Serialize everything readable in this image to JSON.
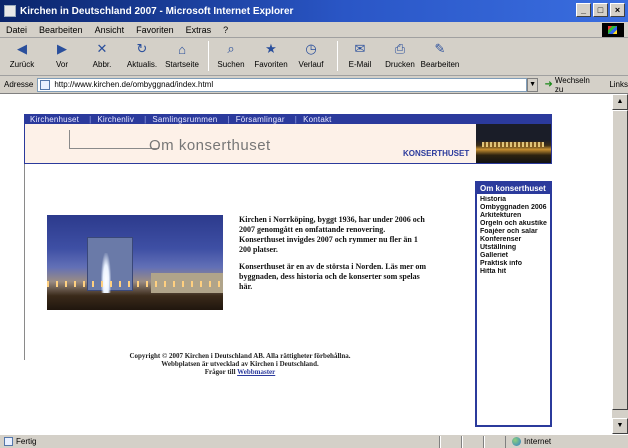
{
  "window": {
    "title": "Kirchen in Deutschland 2007 - Microsoft Internet Explorer"
  },
  "menu": {
    "items": [
      "Datei",
      "Bearbeiten",
      "Ansicht",
      "Favoriten",
      "Extras",
      "?"
    ]
  },
  "toolbar": {
    "buttons": [
      {
        "label": "Zurück",
        "icon": "back-icon"
      },
      {
        "label": "Vor",
        "icon": "forward-icon"
      },
      {
        "label": "Abbr.",
        "icon": "stop-icon"
      },
      {
        "label": "Aktualis.",
        "icon": "refresh-icon"
      },
      {
        "label": "Startseite",
        "icon": "home-icon"
      },
      {
        "label": "Suchen",
        "icon": "search-icon"
      },
      {
        "label": "Favoriten",
        "icon": "favorites-icon"
      },
      {
        "label": "Verlauf",
        "icon": "history-icon"
      },
      {
        "label": "E-Mail",
        "icon": "mail-icon"
      },
      {
        "label": "Drucken",
        "icon": "print-icon"
      },
      {
        "label": "Bearbeiten",
        "icon": "edit-icon"
      }
    ]
  },
  "address": {
    "label": "Adresse",
    "url": "http://www.kirchen.de/ombyggnad/index.html",
    "go_label": "Wechseln zu",
    "links_label": "Links"
  },
  "site": {
    "nav": [
      "Kirchenhuset",
      "Kirchenliv",
      "Samlingsrummen",
      "Församlingar",
      "Kontakt"
    ],
    "section_title": "Om konserthuset",
    "logo_text": "KONSERTHUSET",
    "intro": [
      "Kirchen i Norrköping, byggt 1936, har under 2006 och 2007 genomgått en omfattande renovering. Konserthuset invigdes 2007 och rymmer nu fler än 1 200 platser.",
      "Konserthuset är en av de största i Norden. Läs mer om byggnaden, dess historia och de konserter som spelas här."
    ],
    "footer": {
      "line1": "Copyright © 2007 Kirchen i Deutschland AB. Alla rättigheter förbehållna.",
      "line2": "Webbplatsen är utvecklad av Kirchen i Deutschland.",
      "line3_prefix": "Frågor till",
      "link": "Webbmaster"
    },
    "sidebar": {
      "title": "Om konserthuset",
      "items": [
        "Historia",
        "Ombyggnaden 2006",
        "Arkitekturen",
        "Orgeln och akustiken",
        "Foajéer och salar",
        "Konferenser",
        "Utställning",
        "Galleriet",
        "Praktisk info",
        "Hitta hit"
      ]
    }
  },
  "status": {
    "text": "Fertig",
    "zone": "Internet"
  }
}
